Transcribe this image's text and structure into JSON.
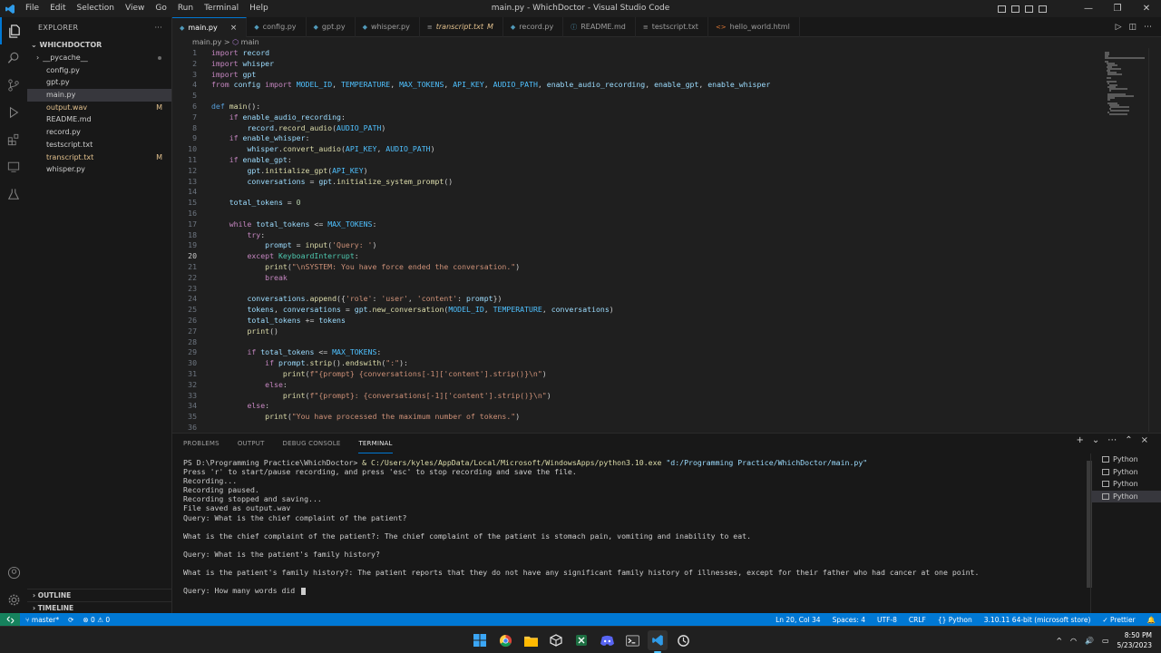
{
  "window": {
    "title": "main.py - WhichDoctor - Visual Studio Code",
    "menu": [
      "File",
      "Edit",
      "Selection",
      "View",
      "Go",
      "Run",
      "Terminal",
      "Help"
    ]
  },
  "sidebar": {
    "header": "EXPLORER",
    "header_more": "···",
    "root": "WHICHDOCTOR",
    "files": [
      {
        "name": "__pycache__",
        "status": ""
      },
      {
        "name": "config.py",
        "status": ""
      },
      {
        "name": "gpt.py",
        "status": ""
      },
      {
        "name": "main.py",
        "status": ""
      },
      {
        "name": "output.wav",
        "status": "M"
      },
      {
        "name": "README.md",
        "status": ""
      },
      {
        "name": "record.py",
        "status": ""
      },
      {
        "name": "testscript.txt",
        "status": ""
      },
      {
        "name": "transcript.txt",
        "status": "M"
      },
      {
        "name": "whisper.py",
        "status": ""
      }
    ],
    "outline": "OUTLINE",
    "timeline": "TIMELINE"
  },
  "tabs": [
    {
      "label": "main.py",
      "suffix": "×"
    },
    {
      "label": "config.py",
      "suffix": ""
    },
    {
      "label": "gpt.py",
      "suffix": ""
    },
    {
      "label": "whisper.py",
      "suffix": ""
    },
    {
      "label": "transcript.txt",
      "suffix": "M"
    },
    {
      "label": "record.py",
      "suffix": ""
    },
    {
      "label": "README.md",
      "suffix": ""
    },
    {
      "label": "testscript.txt",
      "suffix": ""
    },
    {
      "label": "hello_world.html",
      "suffix": ""
    }
  ],
  "breadcrumb": {
    "file": "main.py",
    "separator": ">",
    "symbol": "main"
  },
  "editor": {
    "current_line": 20,
    "lines": [
      "import record",
      "import whisper",
      "import gpt",
      "from config import MODEL_ID, TEMPERATURE, MAX_TOKENS, API_KEY, AUDIO_PATH, enable_audio_recording, enable_gpt, enable_whisper",
      "",
      "def main():",
      "    if enable_audio_recording:",
      "        record.record_audio(AUDIO_PATH)",
      "    if enable_whisper:",
      "        whisper.convert_audio(API_KEY, AUDIO_PATH)",
      "    if enable_gpt:",
      "        gpt.initialize_gpt(API_KEY)",
      "        conversations = gpt.initialize_system_prompt()",
      "",
      "    total_tokens = 0",
      "",
      "    while total_tokens <= MAX_TOKENS:",
      "        try:",
      "            prompt = input('Query: ')",
      "        except KeyboardInterrupt:",
      "            print(\"\\nSYSTEM: You have force ended the conversation.\")",
      "            break",
      "",
      "        conversations.append({'role': 'user', 'content': prompt})",
      "        tokens, conversations = gpt.new_conversation(MODEL_ID, TEMPERATURE, conversations)",
      "        total_tokens += tokens",
      "        print()",
      "",
      "        if total_tokens <= MAX_TOKENS:",
      "            if prompt.strip().endswith(\":\"):",
      "                print(f\"{prompt} {conversations[-1]['content'].strip()}\\n\")",
      "            else:",
      "                print(f\"{prompt}: {conversations[-1]['content'].strip()}\\n\")",
      "        else:",
      "            print(\"You have processed the maximum number of tokens.\")",
      ""
    ]
  },
  "panel": {
    "tabs": [
      "PROBLEMS",
      "OUTPUT",
      "DEBUG CONSOLE",
      "TERMINAL"
    ],
    "active_tab": "TERMINAL",
    "actions": [
      "+",
      "⌄",
      "⋯",
      "⌃",
      "×"
    ],
    "terminal": {
      "prompt": "PS D:\\Programming Practice\\WhichDoctor> ",
      "cmd_amp": "& ",
      "cmd_exe": "C:/Users/kyles/AppData/Local/Microsoft/WindowsApps/python3.10.exe",
      "cmd_arg": " \"d:/Programming Practice/WhichDoctor/main.py\"",
      "output": [
        "Press 'r' to start/pause recording, and press 'esc' to stop recording and save the file.",
        "Recording...",
        "Recording paused.",
        "Recording stopped and saving...",
        "File saved as output.wav",
        "Query: What is the chief complaint of the patient?",
        "",
        "What is the chief complaint of the patient?: The chief complaint of the patient is stomach pain, vomiting and inability to eat.",
        "",
        "Query: What is the patient's family history?",
        "",
        "What is the patient's family history?: The patient reports that they do not have any significant family history of illnesses, except for their father who had cancer at one point.",
        "",
        "Query: How many words did "
      ]
    },
    "terminal_list": [
      "Python",
      "Python",
      "Python",
      "Python"
    ]
  },
  "statusbar": {
    "branch": "master*",
    "sync": "⟳",
    "errors": "⊗ 0 ⚠ 0",
    "position": "Ln 20, Col 34",
    "spaces": "Spaces: 4",
    "encoding": "UTF-8",
    "eol": "CRLF",
    "language": "Python",
    "interpreter": "3.10.11 64-bit (microsoft store)",
    "prettier": "✓ Prettier",
    "bell": "🔔"
  },
  "taskbar": {
    "time": "8:50 PM",
    "date": "5/23/2023",
    "tray_chevron": "^"
  }
}
